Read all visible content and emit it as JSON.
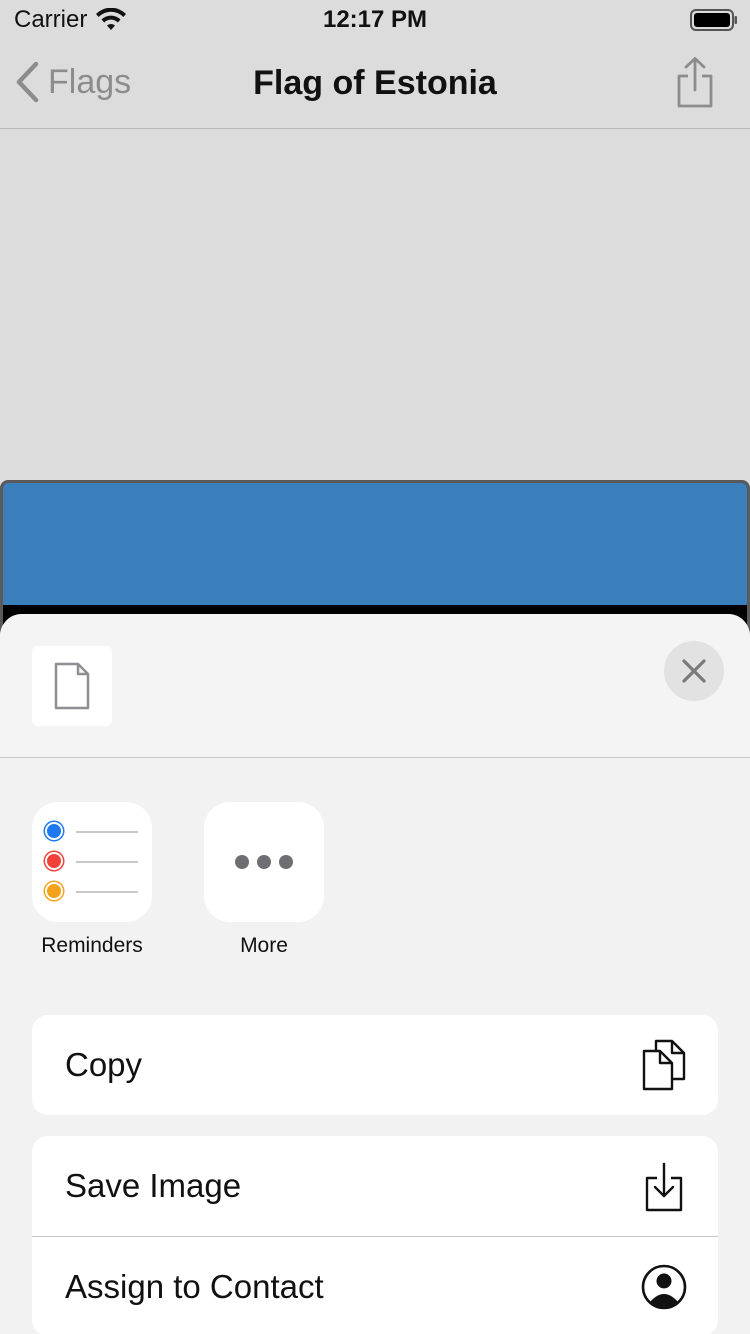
{
  "status_bar": {
    "carrier": "Carrier",
    "time": "12:17 PM"
  },
  "nav": {
    "back_label": "Flags",
    "title": "Flag of Estonia"
  },
  "flag": {
    "colors": [
      "#3c7fbd",
      "#000000"
    ]
  },
  "sheet": {
    "apps": [
      {
        "label": "Reminders",
        "icon": "reminders-icon"
      },
      {
        "label": "More",
        "icon": "more-icon"
      }
    ],
    "actions_group1": [
      {
        "label": "Copy",
        "icon": "copy-icon"
      }
    ],
    "actions_group2": [
      {
        "label": "Save Image",
        "icon": "save-image-icon"
      },
      {
        "label": "Assign to Contact",
        "icon": "contact-icon"
      }
    ]
  }
}
